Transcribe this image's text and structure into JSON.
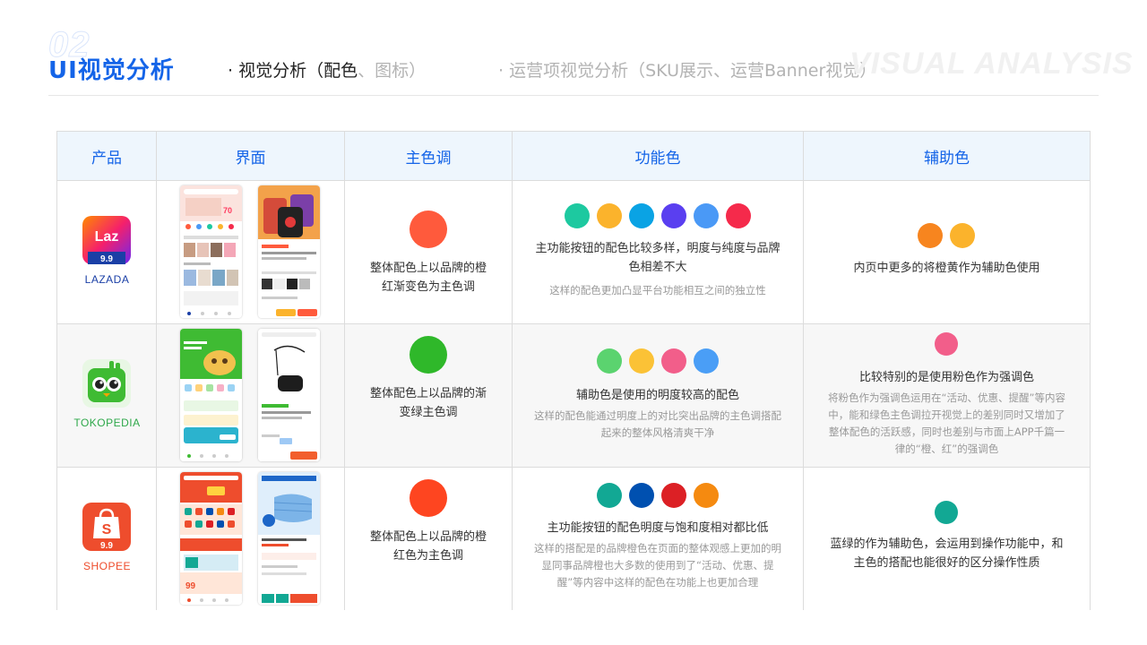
{
  "header": {
    "section_number": "02",
    "title": "UI视觉分析",
    "nav_active_prefix": "· 视觉分析（配色",
    "nav_active_muted": "、图标）",
    "nav_inactive": "· 运营项视觉分析（SKU展示、运营Banner视觉）",
    "watermark": "VISUAL ANALYSIS"
  },
  "table": {
    "headers": [
      "产品",
      "界面",
      "主色调",
      "功能色",
      "辅助色"
    ],
    "rows": [
      {
        "brand": "LAZADA",
        "logo_text": "Laz",
        "logo_badge": "9.9",
        "brand_color": "#1a3fa6",
        "main_color": "#ff5a3c",
        "main_text": "整体配色上以品牌的橙红渐变色为主色调",
        "func_colors": [
          "#1dc9a0",
          "#fbb32c",
          "#0aa3e4",
          "#5a3ff0",
          "#4a99f6",
          "#f52a4b"
        ],
        "func_main": "主功能按钮的配色比较多样，明度与纯度与品牌色相差不大",
        "func_sub": "这样的配色更加凸显平台功能相互之间的独立性",
        "aux_colors": [
          "#f7851f",
          "#fbb32c"
        ],
        "aux_main": "内页中更多的将橙黄作为辅助色使用",
        "aux_sub": ""
      },
      {
        "brand": "TOKOPEDIA",
        "logo_text": "",
        "logo_badge": "",
        "brand_color": "#2ea84a",
        "main_color": "#2fb82a",
        "main_text": "整体配色上以品牌的渐变绿主色调",
        "func_colors": [
          "#5bd36f",
          "#fbc236",
          "#f25e8a",
          "#4a9ef6"
        ],
        "func_main": "辅助色是使用的明度较高的配色",
        "func_sub": "这样的配色能通过明度上的对比突出品牌的主色调搭配起来的整体风格清爽干净",
        "aux_colors": [
          "#f25e8a"
        ],
        "aux_main": "比较特别的是使用粉色作为强调色",
        "aux_sub": "将粉色作为强调色运用在“活动、优惠、提醒”等内容中，能和绿色主色调拉开视觉上的差别同时又增加了整体配色的活跃感，同时也差别与市面上APP千篇一律的“橙、红”的强调色"
      },
      {
        "brand": "SHOPEE",
        "logo_text": "S",
        "logo_badge": "9.9",
        "brand_color": "#ee4d2d",
        "main_color": "#fe4520",
        "main_text": "整体配色上以品牌的橙红色为主色调",
        "func_colors": [
          "#12a894",
          "#0050b0",
          "#dc2025",
          "#f58a10"
        ],
        "func_main": "主功能按钮的配色明度与饱和度相对都比低",
        "func_sub": "这样的搭配是的品牌橙色在页面的整体观感上更加的明显同事品牌橙也大多数的使用到了“活动、优惠、提醒”等内容中这样的配色在功能上也更加合理",
        "aux_colors": [
          "#12a894"
        ],
        "aux_main": "蓝绿的作为辅助色，会运用到操作功能中，和主色的搭配也能很好的区分操作性质",
        "aux_sub": ""
      }
    ]
  }
}
